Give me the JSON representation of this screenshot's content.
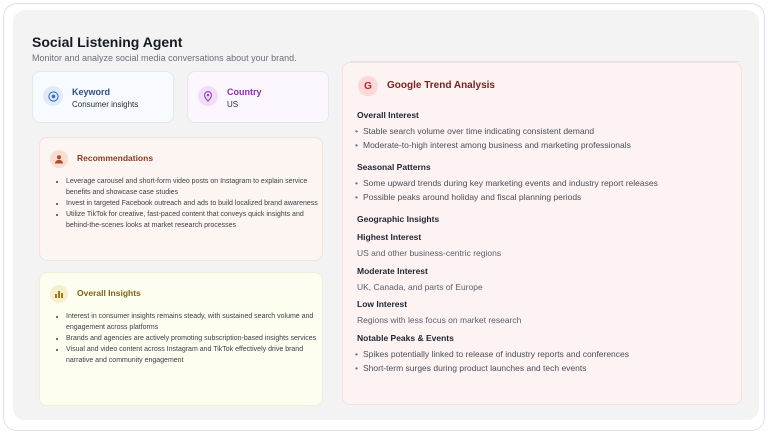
{
  "app": {
    "title": "Social Listening Agent",
    "subtitle": "Monitor and analyze social media conversations about your brand."
  },
  "keyword": {
    "label": "Keyword",
    "value": "Consumer insights",
    "icon": "target-icon"
  },
  "country": {
    "label": "Country",
    "value": "US",
    "icon": "location-icon"
  },
  "recommendations": {
    "title": "Recommendations",
    "icon": "user-icon",
    "items": [
      "Leverage carousel and short-form video posts on Instagram to explain service benefits and showcase case studies",
      "Invest in targeted Facebook outreach and ads to build localized brand awareness",
      "Utilize TikTok for creative, fast-paced content that conveys quick insights and behind-the-scenes looks at market research processes"
    ]
  },
  "insights": {
    "title": "Overall Insights",
    "icon": "chart-icon",
    "items": [
      "Interest in consumer insights remains steady, with sustained search volume and engagement across platforms",
      "Brands and agencies are actively promoting subscription-based insights services",
      "Visual and video content across Instagram and TikTok effectively drive brand narrative and community engagement"
    ]
  },
  "trend": {
    "icon_letter": "G",
    "title": "Google Trend Analysis",
    "overall_interest": {
      "heading": "Overall Interest",
      "items": [
        "Stable search volume over time indicating consistent demand",
        "Moderate-to-high interest among business and marketing professionals"
      ]
    },
    "seasonal": {
      "heading": "Seasonal Patterns",
      "items": [
        "Some upward trends during key marketing events and industry report releases",
        "Possible peaks around holiday and fiscal planning periods"
      ]
    },
    "geographic": {
      "heading": "Geographic Insights",
      "highest_heading": "Highest Interest",
      "highest_text": "US and other business-centric regions",
      "moderate_heading": "Moderate Interest",
      "moderate_text": "UK, Canada, and parts of Europe",
      "low_heading": "Low Interest",
      "low_text": "Regions with less focus on market research"
    },
    "peaks": {
      "heading": "Notable Peaks & Events",
      "items": [
        "Spikes potentially linked to release of industry reports and conferences",
        "Short-term surges during product launches and tech events"
      ]
    }
  }
}
